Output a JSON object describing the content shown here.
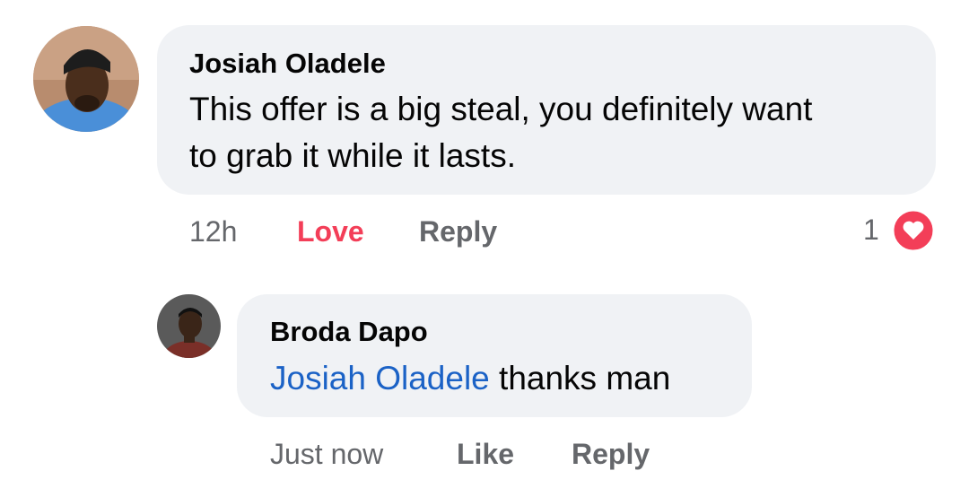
{
  "comment": {
    "author": "Josiah Oladele",
    "text_line1": "This offer is a big steal, you definitely want",
    "text_line2": "to grab it while it lasts.",
    "time": "12h",
    "reaction_label": "Love",
    "reply_label": "Reply",
    "reaction_count": "1",
    "reaction_icon": "heart-icon",
    "reaction_color": "#f33e58"
  },
  "reply": {
    "author": "Broda Dapo",
    "mention": "Josiah Oladele",
    "text": " thanks man",
    "time": "Just now",
    "like_label": "Like",
    "reply_label": "Reply"
  },
  "colors": {
    "bubble": "#f0f2f5",
    "meta_text": "#65676b",
    "mention": "#1b62c6",
    "love": "#f33e58"
  }
}
